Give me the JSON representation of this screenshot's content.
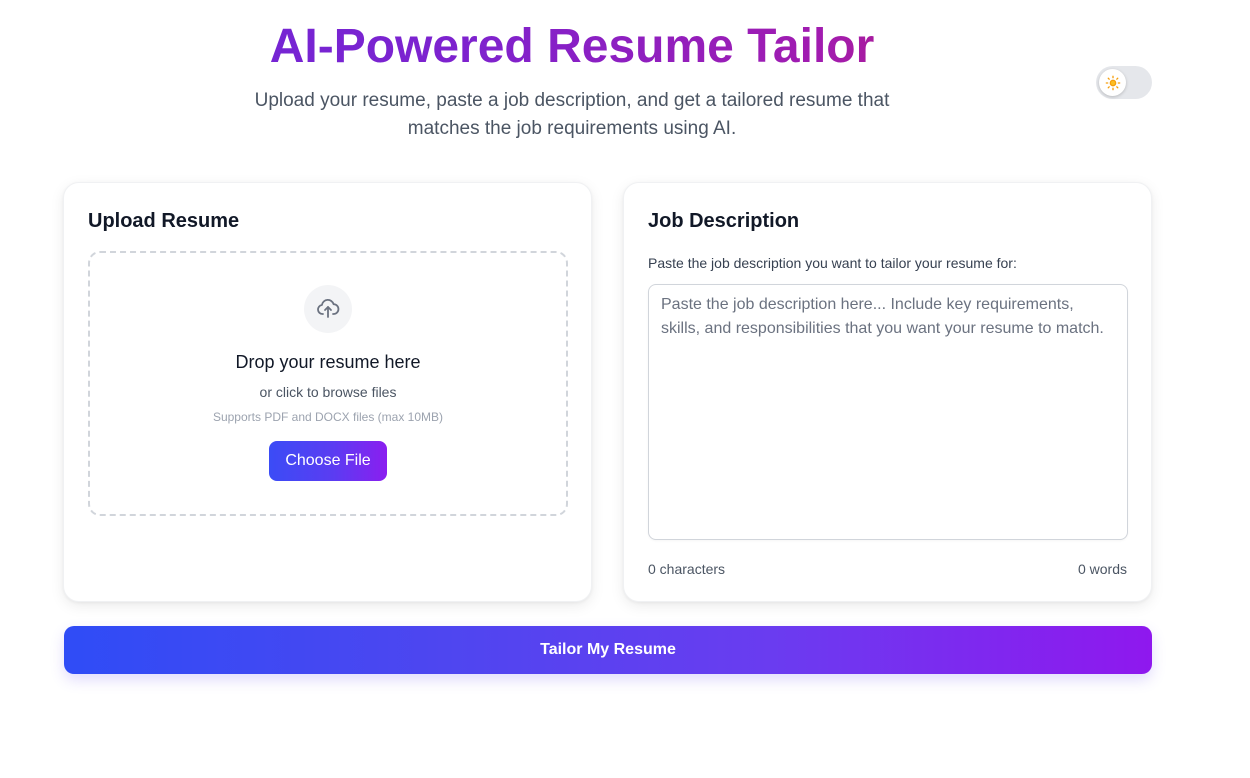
{
  "header": {
    "title": "AI-Powered Resume Tailor",
    "subtitle": "Upload your resume, paste a job description, and get a tailored resume that matches the job requirements using AI."
  },
  "theme_toggle": {
    "icon": "sun-icon",
    "mode": "light"
  },
  "upload_card": {
    "title": "Upload Resume",
    "icon": "cloud-upload-icon",
    "drop_heading": "Drop your resume here",
    "drop_sub": "or click to browse files",
    "drop_note": "Supports PDF and DOCX files (max 10MB)",
    "choose_button": "Choose File"
  },
  "job_card": {
    "title": "Job Description",
    "label": "Paste the job description you want to tailor your resume for:",
    "textarea_value": "",
    "textarea_placeholder": "Paste the job description here... Include key requirements, skills, and responsibilities that you want your resume to match.",
    "char_count": "0 characters",
    "word_count": "0 words"
  },
  "actions": {
    "tailor_button": "Tailor My Resume"
  },
  "colors": {
    "title_gradient_start": "#6d28d9",
    "title_gradient_end": "#be185d",
    "button_gradient_start": "#2f4cf6",
    "button_gradient_end": "#8f18ee"
  }
}
